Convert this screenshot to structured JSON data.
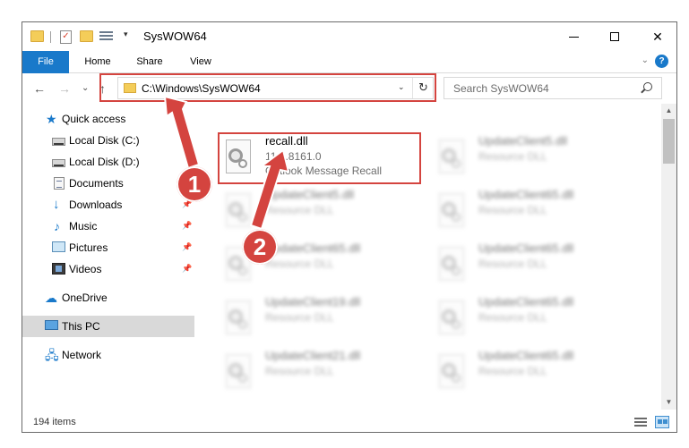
{
  "titlebar": {
    "title": "SysWOW64",
    "minimize_glyph": "",
    "close_glyph": "✕"
  },
  "ribbon": {
    "tabs": [
      "File",
      "Home",
      "Share",
      "View"
    ],
    "collapse_glyph": "⌄",
    "help_glyph": "?"
  },
  "navbar": {
    "back_glyph": "←",
    "forward_glyph": "→",
    "recent_glyph": "⌄",
    "up_glyph": "↑",
    "address": "C:\\Windows\\SysWOW64",
    "address_dropdown_glyph": "⌄",
    "refresh_glyph": "↻",
    "search_placeholder": "Search SysWOW64"
  },
  "sidebar": {
    "items": [
      {
        "label": "Quick access",
        "icon": "star-icon",
        "pinned": false
      },
      {
        "label": "Local Disk (C:)",
        "icon": "disk-icon",
        "pinned": false
      },
      {
        "label": "Local Disk (D:)",
        "icon": "disk-icon",
        "pinned": false
      },
      {
        "label": "Documents",
        "icon": "documents-icon",
        "pinned": true
      },
      {
        "label": "Downloads",
        "icon": "downloads-icon",
        "pinned": true
      },
      {
        "label": "Music",
        "icon": "music-icon",
        "pinned": true
      },
      {
        "label": "Pictures",
        "icon": "pictures-icon",
        "pinned": true
      },
      {
        "label": "Videos",
        "icon": "videos-icon",
        "pinned": true
      },
      {
        "label": "OneDrive",
        "icon": "cloud-icon",
        "pinned": false
      },
      {
        "label": "This PC",
        "icon": "pc-icon",
        "pinned": false,
        "selected": true
      },
      {
        "label": "Network",
        "icon": "network-icon",
        "pinned": false
      }
    ],
    "pin_glyph": "📌"
  },
  "files": [
    {
      "name": "recall.dll",
      "line1": "11.0.8161.0",
      "line2": "Outlook Message Recall",
      "blurred": false
    },
    {
      "name": "UpdateClient5.dll",
      "line1": "Resource DLL",
      "blurred": true
    },
    {
      "name": "UpdateClient5.dll",
      "line1": "Resource DLL",
      "blurred": true
    },
    {
      "name": "UpdateClient65.dll",
      "line1": "Resource DLL",
      "blurred": true
    },
    {
      "name": "UpdateClient65.dll",
      "line1": "Resource DLL",
      "blurred": true
    },
    {
      "name": "UpdateClient65.dll",
      "line1": "Resource DLL",
      "blurred": true
    },
    {
      "name": "UpdateClient19.dll",
      "line1": "Resource DLL",
      "blurred": true
    },
    {
      "name": "UpdateClient65.dll",
      "line1": "Resource DLL",
      "blurred": true
    },
    {
      "name": "UpdateClient21.dll",
      "line1": "Resource DLL",
      "blurred": true
    },
    {
      "name": "UpdateClient65.dll",
      "line1": "Resource DLL",
      "blurred": true
    }
  ],
  "scrollbar": {
    "up_glyph": "▲",
    "down_glyph": "▼"
  },
  "status": {
    "item_count": "194 items"
  },
  "callouts": [
    "1",
    "2"
  ],
  "colors": {
    "accent": "#1979ca",
    "highlight": "#d4443f"
  }
}
